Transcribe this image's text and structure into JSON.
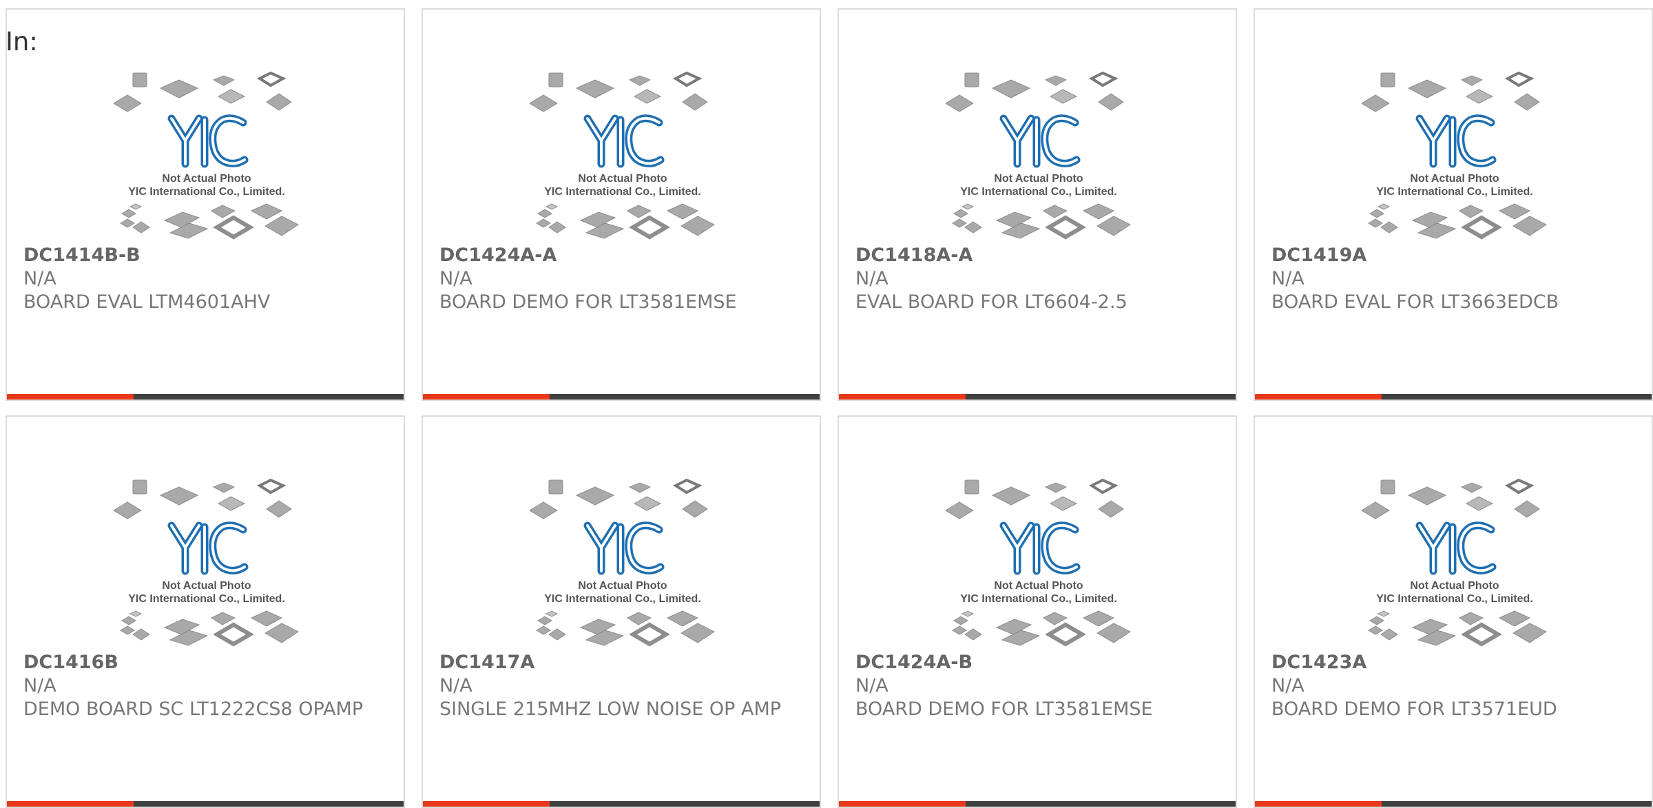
{
  "filter": {
    "label": "In:"
  },
  "placeholder_image": {
    "caption_line1": "Not Actual Photo",
    "caption_line2": "YIC International Co., Limited.",
    "logo_text": "YIC"
  },
  "colors": {
    "accent": "#e8391a",
    "bar": "#404040",
    "logo_blue": "#1f6fb2"
  },
  "products": [
    {
      "part": "DC1414B-B",
      "manufacturer": "N/A",
      "description": "BOARD EVAL LTM4601AHV"
    },
    {
      "part": "DC1424A-A",
      "manufacturer": "N/A",
      "description": "BOARD DEMO FOR LT3581EMSE"
    },
    {
      "part": "DC1418A-A",
      "manufacturer": "N/A",
      "description": "EVAL BOARD FOR LT6604-2.5"
    },
    {
      "part": "DC1419A",
      "manufacturer": "N/A",
      "description": "BOARD EVAL FOR LT3663EDCB"
    },
    {
      "part": "DC1416B",
      "manufacturer": "N/A",
      "description": "DEMO BOARD SC LT1222CS8 OPAMP"
    },
    {
      "part": "DC1417A",
      "manufacturer": "N/A",
      "description": "SINGLE 215MHZ LOW NOISE OP AMP"
    },
    {
      "part": "DC1424A-B",
      "manufacturer": "N/A",
      "description": "BOARD DEMO FOR LT3581EMSE"
    },
    {
      "part": "DC1423A",
      "manufacturer": "N/A",
      "description": "BOARD DEMO FOR LT3571EUD"
    }
  ]
}
